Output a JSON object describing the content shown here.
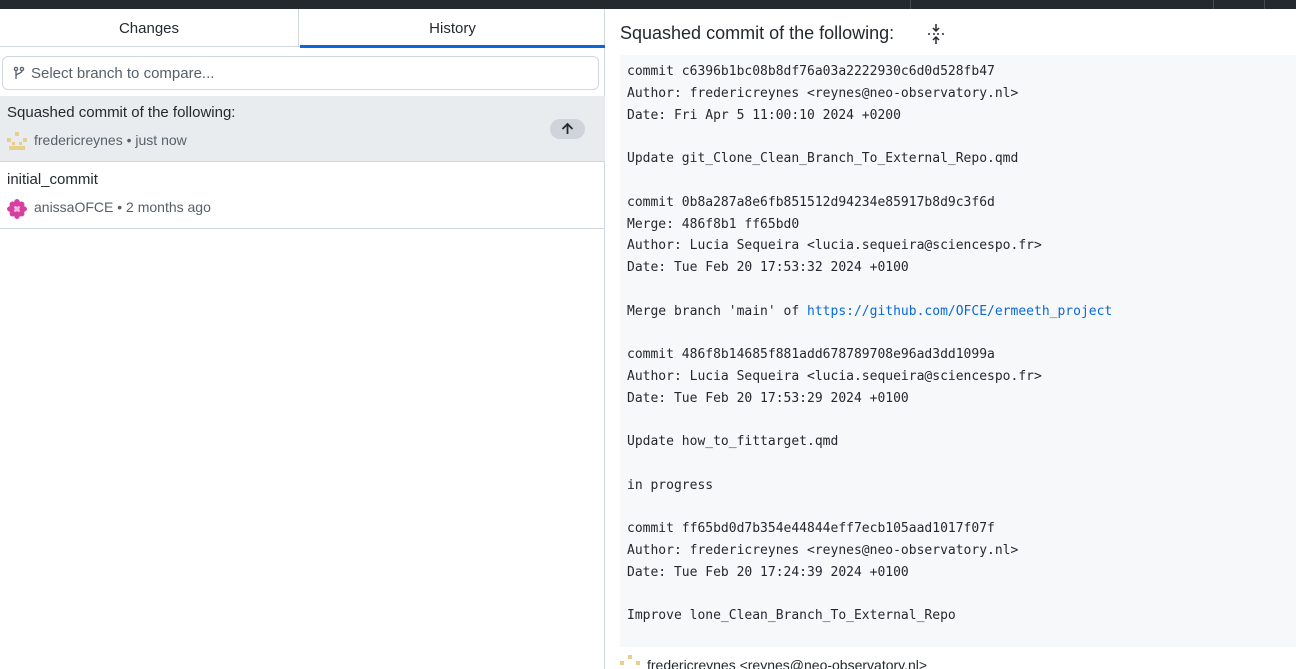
{
  "tabs": {
    "changes_label": "Changes",
    "history_label": "History"
  },
  "branch_compare": {
    "placeholder": "Select branch to compare...",
    "icon": "git-branch-icon"
  },
  "commits": [
    {
      "title": "Squashed commit of the following:",
      "author": "fredericreynes",
      "time": "just now",
      "selected": true,
      "badge_icon": "arrow-up-icon"
    },
    {
      "title": "initial_commit",
      "author": "anissaOFCE",
      "time": "2 months ago",
      "selected": false
    }
  ],
  "detail": {
    "heading": "Squashed commit of the following:",
    "expand_icon": "expand-icon",
    "message_lines": [
      "commit c6396b1bc08b8df76a03a2222930c6d0d528fb47",
      "Author: fredericreynes <reynes@neo-observatory.nl>",
      "Date: Fri Apr 5 11:00:10 2024 +0200",
      "",
      "Update git_Clone_Clean_Branch_To_External_Repo.qmd",
      "",
      "commit 0b8a287a8e6fb851512d94234e85917b8d9c3f6d",
      "Merge: 486f8b1 ff65bd0",
      "Author: Lucia Sequeira <lucia.sequeira@sciencespo.fr>",
      "Date: Tue Feb 20 17:53:32 2024 +0100",
      "",
      "Merge branch 'main' of ",
      "",
      "commit 486f8b14685f881add678789708e96ad3dd1099a",
      "Author: Lucia Sequeira <lucia.sequeira@sciencespo.fr>",
      "Date: Tue Feb 20 17:53:29 2024 +0100",
      "",
      "Update how_to_fittarget.qmd",
      "",
      "in progress",
      "",
      "commit ff65bd0d7b354e44844eff7ecb105aad1017f07f",
      "Author: fredericreynes <reynes@neo-observatory.nl>",
      "Date: Tue Feb 20 17:24:39 2024 +0100",
      "",
      "Improve lone_Clean_Branch_To_External_Repo"
    ],
    "merge_link": "https://github.com/OFCE/ermeeth_project",
    "coauthor": "fredericreynes <reynes@neo-observatory.nl>"
  },
  "colors": {
    "accent": "#0969da",
    "selected_bg": "#e9ecef",
    "message_bg": "#f6f8fa"
  }
}
